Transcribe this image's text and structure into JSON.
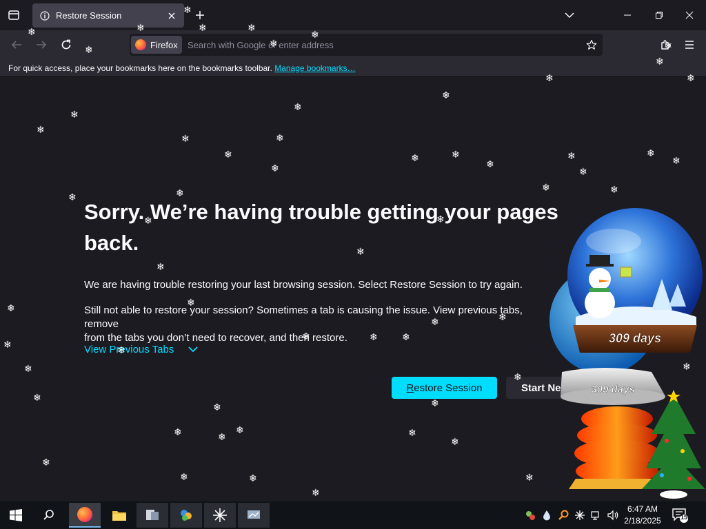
{
  "browser": {
    "tab_title": "Restore Session",
    "identity_label": "Firefox",
    "url_placeholder": "Search with Google or enter address",
    "bookmarks_bar_text": "For quick access, place your bookmarks here on the bookmarks toolbar.",
    "bookmarks_link": "Manage bookmarks…"
  },
  "page": {
    "heading_line1": "Sorry. We’re having trouble getting your pages",
    "heading_line2": "back.",
    "para1": "We are having trouble restoring your last browsing session. Select Restore Session to try again.",
    "para2_line1": "Still not able to restore your session? Sometimes a tab is causing the issue. View previous tabs, remove",
    "para2_line2": "from the tabs you don’t need to recover, and then restore.",
    "view_previous_tabs": "View Previous Tabs",
    "restore_button_first": "R",
    "restore_button_rest": "estore Session",
    "start_new_button": "Start Ne"
  },
  "widget": {
    "days_label_1": "309 days",
    "days_label_2": "309 days"
  },
  "taskbar": {
    "time": "6:47 AM",
    "date": "2/18/2025",
    "notification_count": "15",
    "apps": [
      "start",
      "search",
      "firefox",
      "file-explorer",
      "app-1",
      "app-2",
      "app-3",
      "app-4"
    ]
  },
  "colors": {
    "accent": "#00ddff",
    "background": "#1c1b22",
    "toolbar": "#2b2a33",
    "tab_active": "#42414d"
  }
}
